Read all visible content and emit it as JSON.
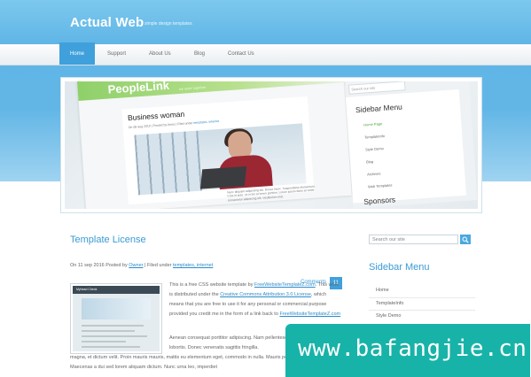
{
  "header": {
    "title": "Actual Web",
    "tagline": "simple design templates"
  },
  "nav": {
    "items": [
      "Home",
      "Support",
      "About Us",
      "Blog",
      "Contact Us"
    ],
    "active": "Home"
  },
  "slider": {
    "logo": "PeopleLink",
    "logo_sub": "we work together",
    "post_title": "Business woman",
    "post_meta": "On 08 aug 2010 | Posted by Anna | Filed under",
    "post_meta_links": "templates, internet",
    "post_text": "Nunc aliquam adipiscing elit. Donec Nunc. Suspendisse elementum. Cras id ante. Ut in leo at lorem porttitor. Lorem ipsum dolor sit amet consectetur adipiscing elit. Vestibulum erat.",
    "search_placeholder": "Search our site",
    "sidebar_title": "Sidebar Menu",
    "sidebar_items": [
      "Home Page",
      "TemplateInfo",
      "Style Demo",
      "Blog",
      "Archives",
      "Web Templates"
    ],
    "sponsors_title": "Sponsors"
  },
  "post": {
    "title": "Template License",
    "meta_prefix": "On 11 sep 2016 Posted by",
    "author": "Owner",
    "filed_label": "| Filed under",
    "tags": "templates, internet",
    "comments_label": "Comments",
    "comments_count": "11",
    "thumb_header": "Myhead Check",
    "para1_a": "This is a free CSS website template by",
    "para1_link1": "FreeWebsiteTemplateZ.com",
    "para1_b": ". This work is distributed under the",
    "para1_link2": "Creative Commons Attribution 3.0 License",
    "para1_c": ", which means that you are free to use it for any personal or commercial purpose provided you credit me in the form of a link back to",
    "para1_link3": "FreeWebsiteTemplateZ.com",
    "para2": "Aenean consequat porttitor adipiscing. Nam pellentesque justo ut tortor congue lobortis. Donec venenatis sagittis fringilla.",
    "para3": "magna, et dictum velit. Proin mauris mauris, mattis eu elementum eget, commodo in nulla. Mauris posuere venenatis pretium. Maecenas a dui sed lorem aliquam dictum. Nunc urna leo, imperdiet"
  },
  "sidebar": {
    "search_placeholder": "Search our site",
    "search_button_icon": "search-icon",
    "title": "Sidebar Menu",
    "items": [
      "Home",
      "TemplateInfo",
      "Style Demo"
    ]
  },
  "watermark": {
    "text": "www.bafangjie.cn"
  },
  "colors": {
    "accent": "#3fa0dc",
    "header_bg": "#62b6e6",
    "watermark_bg": "#18b3a8"
  }
}
